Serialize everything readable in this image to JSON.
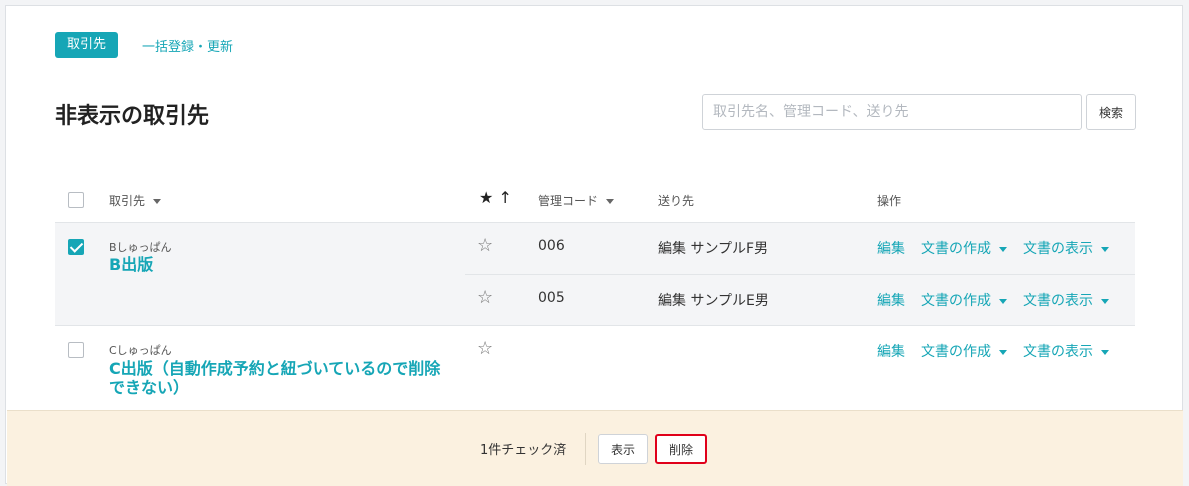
{
  "tabs": {
    "active": "取引先",
    "bulk": "一括登録・更新"
  },
  "page_title": "非表示の取引先",
  "search": {
    "placeholder": "取引先名、管理コード、送り先",
    "button": "検索"
  },
  "table": {
    "headers": {
      "partner": "取引先",
      "code": "管理コード",
      "recipient": "送り先",
      "actions": "操作",
      "sort_arrow": "↑"
    },
    "groups": [
      {
        "kana": "Bしゅっぱん",
        "name": "B出版",
        "checked": true,
        "rows": [
          {
            "code": "006",
            "recipient": "編集 サンプルF男"
          },
          {
            "code": "005",
            "recipient": "編集 サンプルE男"
          }
        ]
      },
      {
        "kana": "Cしゅっぱん",
        "name": "C出版（自動作成予約と紐づいているので削除できない）",
        "checked": false,
        "rows": [
          {
            "code": "",
            "recipient": ""
          }
        ]
      }
    ],
    "actions": {
      "edit": "編集",
      "create_doc": "文書の作成",
      "show_doc": "文書の表示"
    }
  },
  "footer": {
    "checked_count": "1件チェック済",
    "show_button": "表示",
    "delete_button": "削除"
  },
  "colors": {
    "accent": "#16a6b6",
    "danger": "#e0001a",
    "footer_bg": "#fbf1e0"
  }
}
